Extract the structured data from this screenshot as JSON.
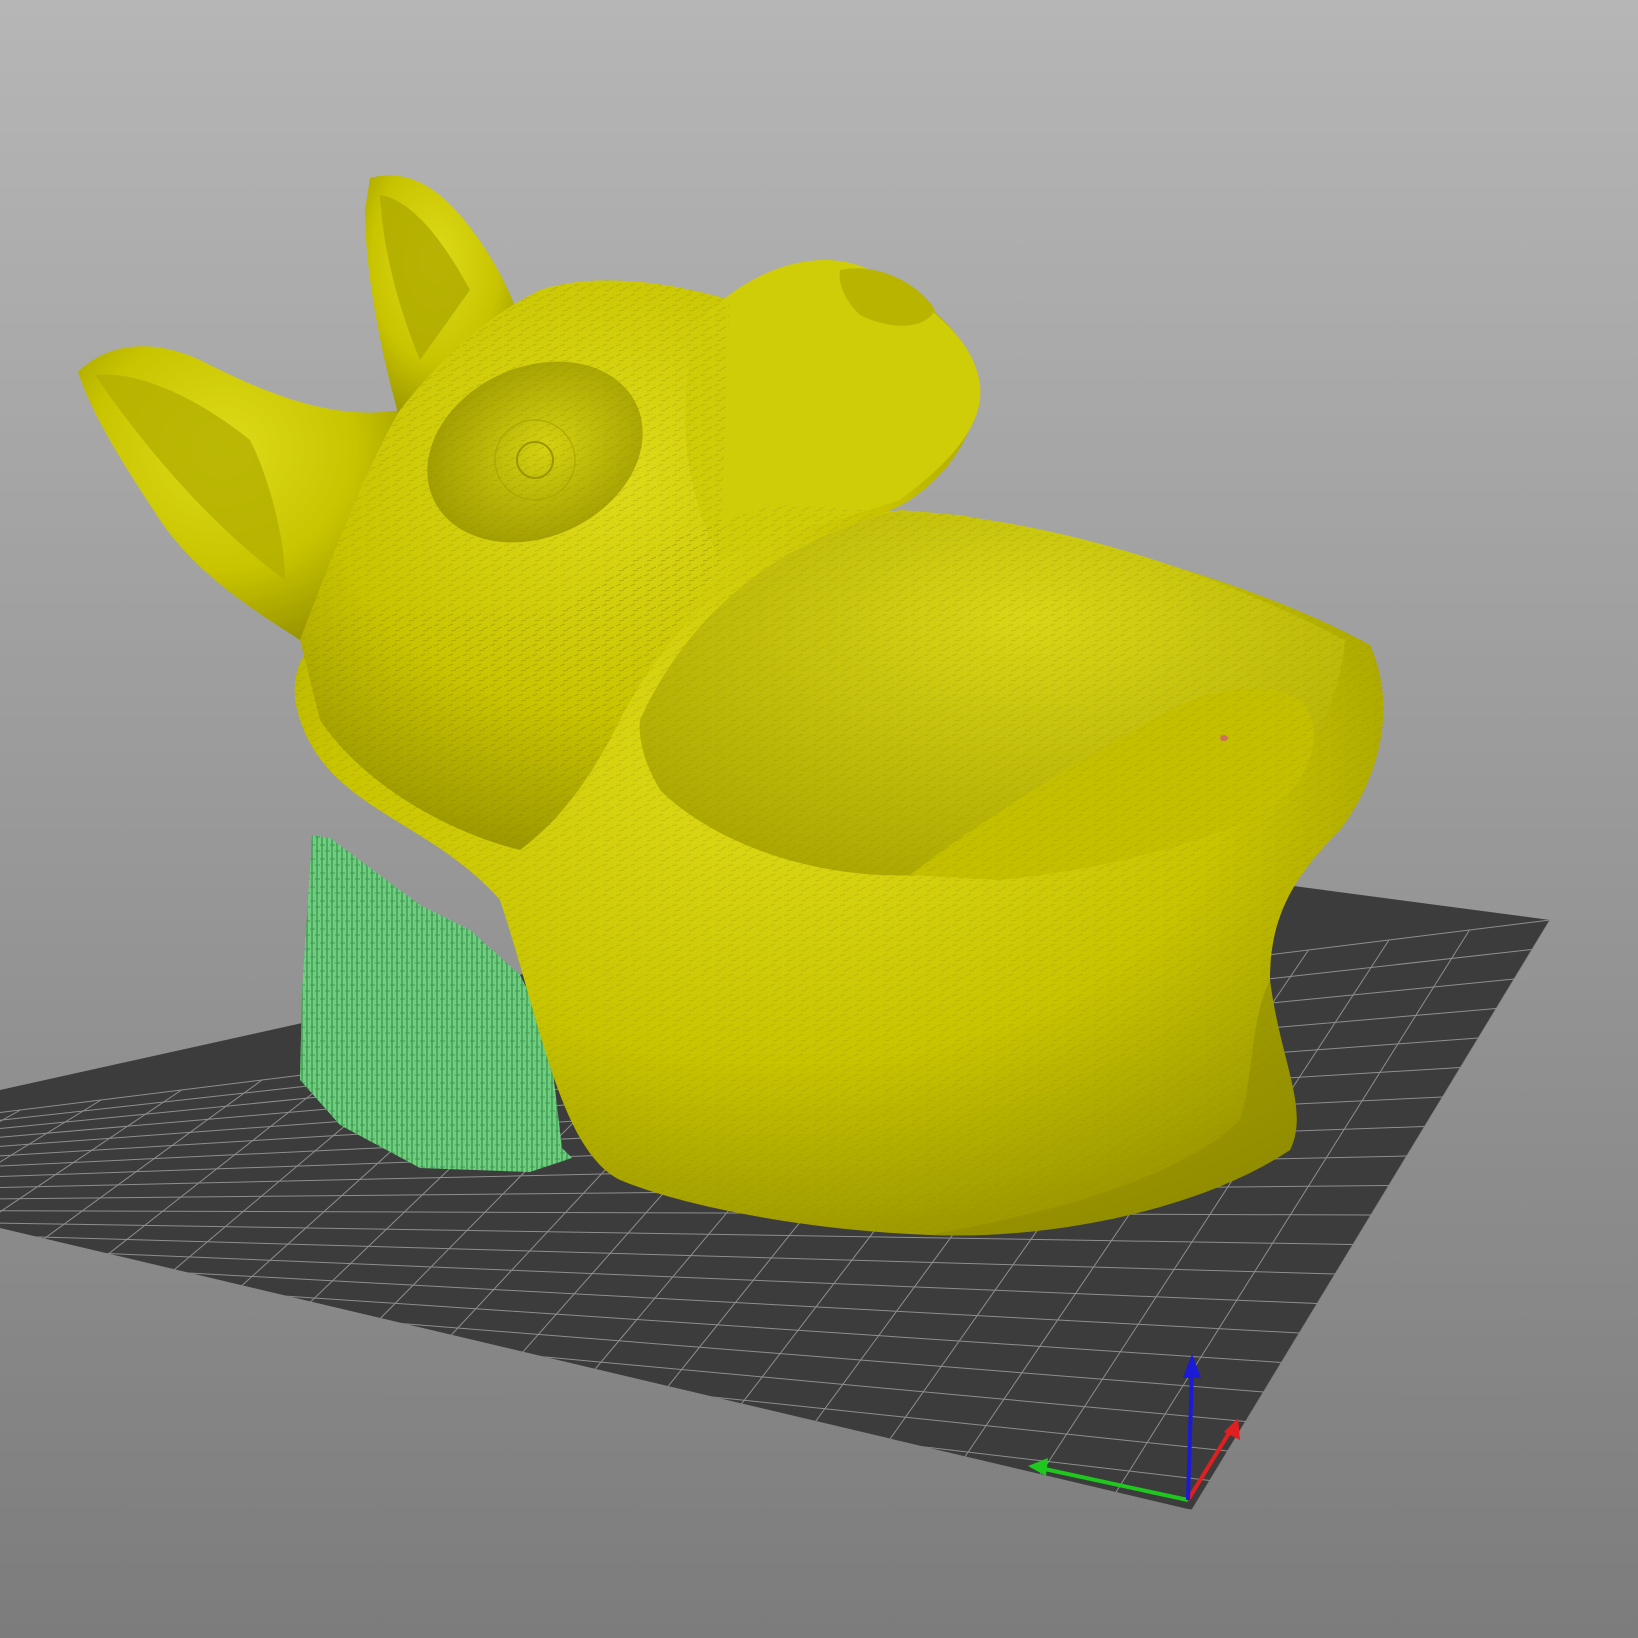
{
  "viewport": {
    "background_top": "#b6b6b6",
    "background_bottom": "#7c7c7c"
  },
  "scene": {
    "build_plate": {
      "color": "#3c3c3c",
      "grid_color": "#8e8e8e",
      "grid_divisions": 20
    },
    "model": {
      "name": "fox-head-bowl",
      "color": "#c8c400",
      "shadow_color": "#8e8a00",
      "highlight_color": "#dedb1a"
    },
    "support": {
      "color": "#6fcf7f",
      "edge_color": "#3f9a52"
    },
    "axes": {
      "x_color": "#e02020",
      "y_color": "#1ec81e",
      "z_color": "#1a1ad8"
    }
  }
}
